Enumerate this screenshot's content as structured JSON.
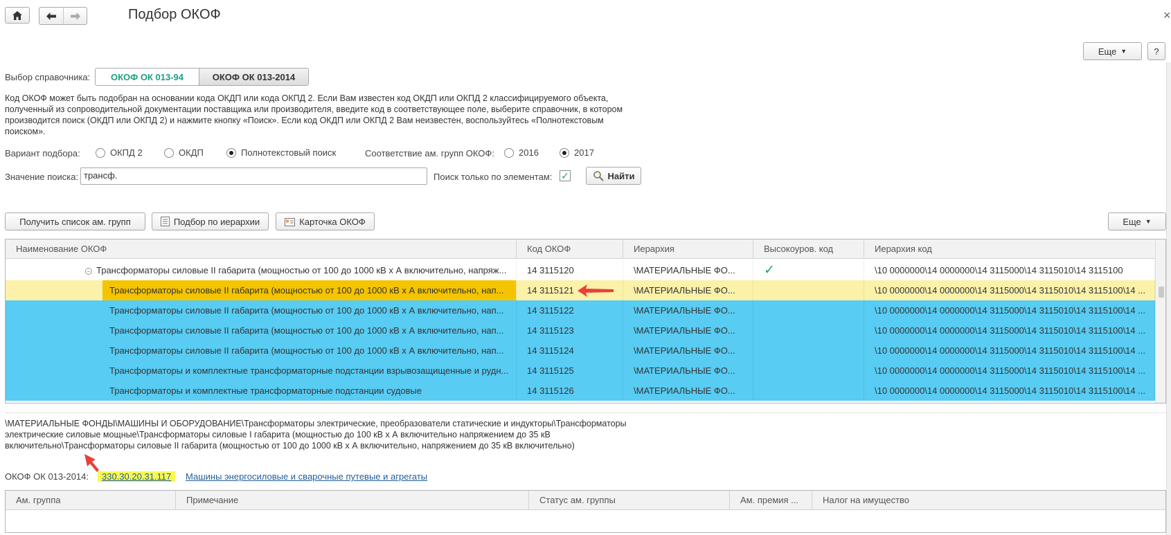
{
  "window": {
    "title": "Подбор ОКОФ",
    "more_label": "Еще",
    "help_label": "?",
    "close_label": "×"
  },
  "nav": {
    "home_icon": "home-icon",
    "back_icon": "arrow-left-icon",
    "forward_icon": "arrow-right-icon"
  },
  "directory": {
    "label": "Выбор справочника:",
    "options": [
      "ОКОФ ОК 013-94",
      "ОКОФ ОК 013-2014"
    ],
    "selected": "ОКОФ ОК 013-94"
  },
  "description": "Код ОКОФ может быть подобран на основании кода ОКДП или кода ОКПД 2. Если Вам известен код ОКДП или ОКПД 2 классифицируемого объекта, полученный из сопроводительной документации поставщика или производителя, введите код в соответствующее поле, выберите справочник, в котором производится поиск (ОКДП или ОКПД 2) и нажмите кнопку «Поиск». Если код ОКДП или ОКПД 2 Вам неизвестен, воспользуйтесь «Полнотекстовым поиском».",
  "selection": {
    "label": "Вариант подбора:",
    "options": [
      "ОКПД 2",
      "ОКДП",
      "Полнотекстовый поиск"
    ],
    "selected": "Полнотекстовый поиск",
    "match_label": "Соответствие ам. групп  ОКОФ:",
    "match_options": [
      "2016",
      "2017"
    ],
    "match_selected": "2017"
  },
  "search": {
    "label": "Значение поиска:",
    "value": "трансф.",
    "only_elements_label": "Поиск только по элементам:",
    "only_elements_checked": true,
    "find_label": "Найти"
  },
  "toolbar": {
    "get_groups_label": "Получить список ам. групп",
    "hierarchy_label": "Подбор по иерархии",
    "card_label": "Карточка ОКОФ",
    "more_label": "Еще"
  },
  "table": {
    "columns": [
      "Наименование ОКОФ",
      "Код ОКОФ",
      "Иерархия",
      "Высокоуров. код",
      "Иерархия код"
    ],
    "rows": [
      {
        "name": "Трансформаторы силовые II габарита (мощностью от 100 до 1000 кВ х А включительно, напряж...",
        "code": "14 3115120",
        "hier": "\\МАТЕРИАЛЬНЫЕ ФО...",
        "high": "✓",
        "hiercode": "\\10 0000000\\14 0000000\\14 3115000\\14 3115010\\14 3115100"
      },
      {
        "name": "Трансформаторы силовые II габарита (мощностью от 100 до 1000 кВ х А включительно, нап...",
        "code": "14 3115121",
        "hier": "\\МАТЕРИАЛЬНЫЕ ФО...",
        "high": "",
        "hiercode": "\\10 0000000\\14 0000000\\14 3115000\\14 3115010\\14 3115100\\14 ..."
      },
      {
        "name": "Трансформаторы силовые II габарита (мощностью от 100 до 1000 кВ х А включительно, нап...",
        "code": "14 3115122",
        "hier": "\\МАТЕРИАЛЬНЫЕ ФО...",
        "high": "",
        "hiercode": "\\10 0000000\\14 0000000\\14 3115000\\14 3115010\\14 3115100\\14 ..."
      },
      {
        "name": "Трансформаторы силовые II габарита (мощностью от 100 до 1000 кВ х А включительно, нап...",
        "code": "14 3115123",
        "hier": "\\МАТЕРИАЛЬНЫЕ ФО...",
        "high": "",
        "hiercode": "\\10 0000000\\14 0000000\\14 3115000\\14 3115010\\14 3115100\\14 ..."
      },
      {
        "name": "Трансформаторы силовые II габарита (мощностью от 100 до 1000 кВ х А включительно, нап...",
        "code": "14 3115124",
        "hier": "\\МАТЕРИАЛЬНЫЕ ФО...",
        "high": "",
        "hiercode": "\\10 0000000\\14 0000000\\14 3115000\\14 3115010\\14 3115100\\14 ..."
      },
      {
        "name": "Трансформаторы и комплектные трансформаторные подстанции взрывозащищенные и рудн...",
        "code": "14 3115125",
        "hier": "\\МАТЕРИАЛЬНЫЕ ФО...",
        "high": "",
        "hiercode": "\\10 0000000\\14 0000000\\14 3115000\\14 3115010\\14 3115100\\14 ..."
      },
      {
        "name": "Трансформаторы и комплектные трансформаторные подстанции судовые",
        "code": "14 3115126",
        "hier": "\\МАТЕРИАЛЬНЫЕ ФО...",
        "high": "",
        "hiercode": "\\10 0000000\\14 0000000\\14 3115000\\14 3115010\\14 3115100\\14 ..."
      }
    ],
    "expand_icon": "collapse-minus-icon"
  },
  "path_text": "\\МАТЕРИАЛЬНЫЕ ФОНДЫ\\МАШИНЫ И ОБОРУДОВАНИЕ\\Трансформаторы электрические, преобразователи статические и индукторы\\Трансформаторы электрические силовые мощные\\Трансформаторы силовые I габарита (мощностью до 100 кВ х А включительно напряжением до 35 кВ включительно\\Трансформаторы силовые II габарита (мощностью от 100 до 1000 кВ х А включительно, напряжением до 35 кВ включительно)",
  "okof2014": {
    "label": "ОКОФ ОК 013-2014:",
    "code": "330.30.20.31.117",
    "name": "Машины энергосиловые и сварочные путевые и агрегаты"
  },
  "lower_table": {
    "columns": [
      "Ам. группа",
      "Примечание",
      "Статус ам. группы",
      "Ам. премия ...",
      "Налог на имущество"
    ]
  },
  "colors": {
    "accent": "#1aa083",
    "row_selected": "#58ccf3",
    "row_current": "#fbf1a8",
    "highlight": "#f5c400",
    "annotation_arrow": "#e8413a"
  }
}
